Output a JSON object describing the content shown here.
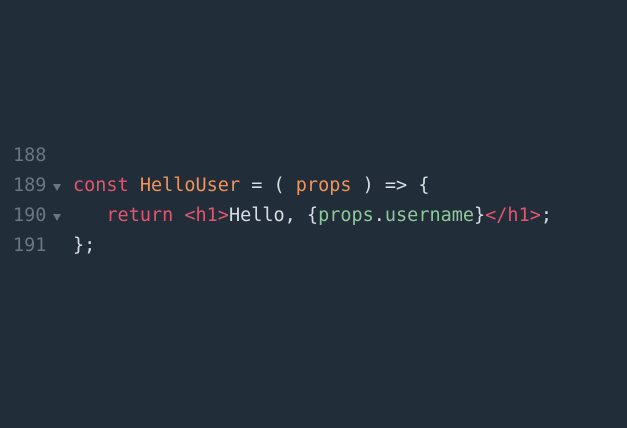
{
  "editor": {
    "lines": [
      {
        "number": "188"
      },
      {
        "number": "189",
        "tokens": {
          "kw_const": "const",
          "sp1": " ",
          "fn_name": "HelloUser",
          "op1": " = ( ",
          "param": "props",
          "op2": " ) => {"
        }
      },
      {
        "number": "190",
        "tokens": {
          "indent": "   ",
          "kw_return": "return",
          "sp1": " ",
          "tag_open": "<h1>",
          "text": "Hello, ",
          "brace_open": "{",
          "obj": "props",
          "dot": ".",
          "prop": "username",
          "brace_close": "}",
          "tag_close": "</h1>",
          "semi": ";"
        }
      },
      {
        "number": "191",
        "tokens": {
          "close": "};"
        }
      }
    ]
  },
  "colors": {
    "background": "#212d38",
    "keyword": "#e2566f",
    "function": "#f2935a",
    "property": "#8fc99a",
    "text": "#d6dde4",
    "gutter": "#6a7682"
  },
  "icons": {
    "fold": "chevron-down-icon"
  }
}
